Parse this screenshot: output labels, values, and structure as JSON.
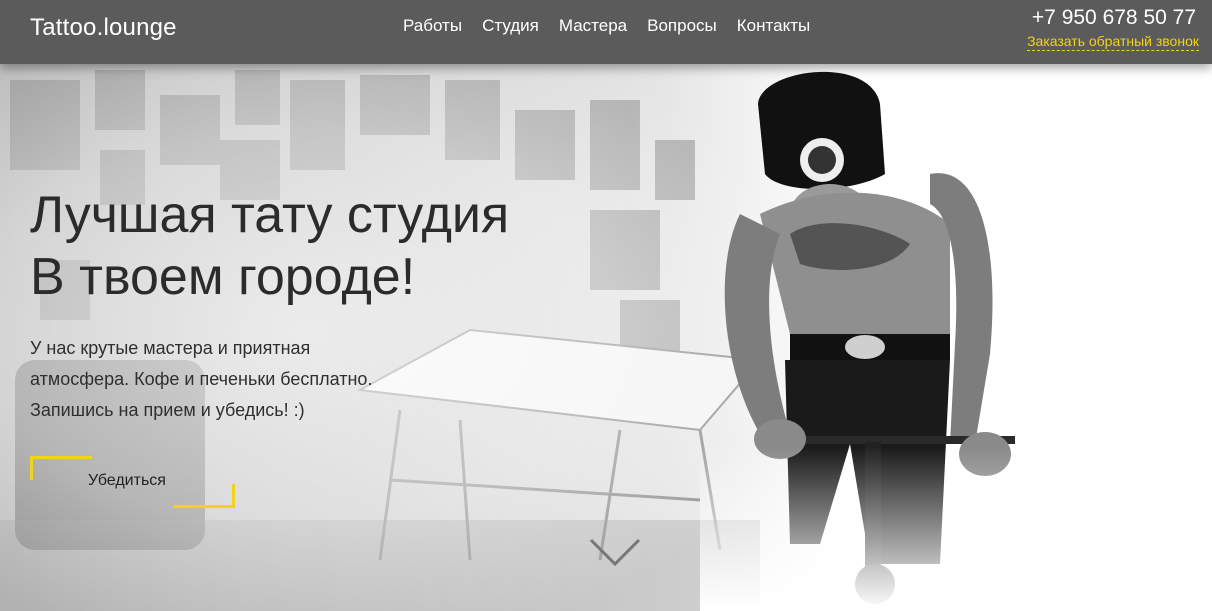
{
  "header": {
    "logo": "Tattoo.lounge",
    "nav": [
      "Работы",
      "Студия",
      "Мастера",
      "Вопросы",
      "Контакты"
    ],
    "phone": "+7 950 678 50 77",
    "callback": "Заказать обратный звонок"
  },
  "hero": {
    "title_line1": "Лучшая тату студия",
    "title_line2": "В твоем городе!",
    "desc_line1": "У нас крутые мастера и приятная",
    "desc_line2": "атмосфера. Кофе и печеньки бесплатно.",
    "desc_line3": "Запишись на прием и убедись! :)",
    "cta_label": "Убедиться",
    "scroll_icon": "chevron-down-icon"
  },
  "colors": {
    "accent": "#f2d21a",
    "header_bg": "#5b5b5b",
    "text_dark": "#2b2b2b"
  }
}
